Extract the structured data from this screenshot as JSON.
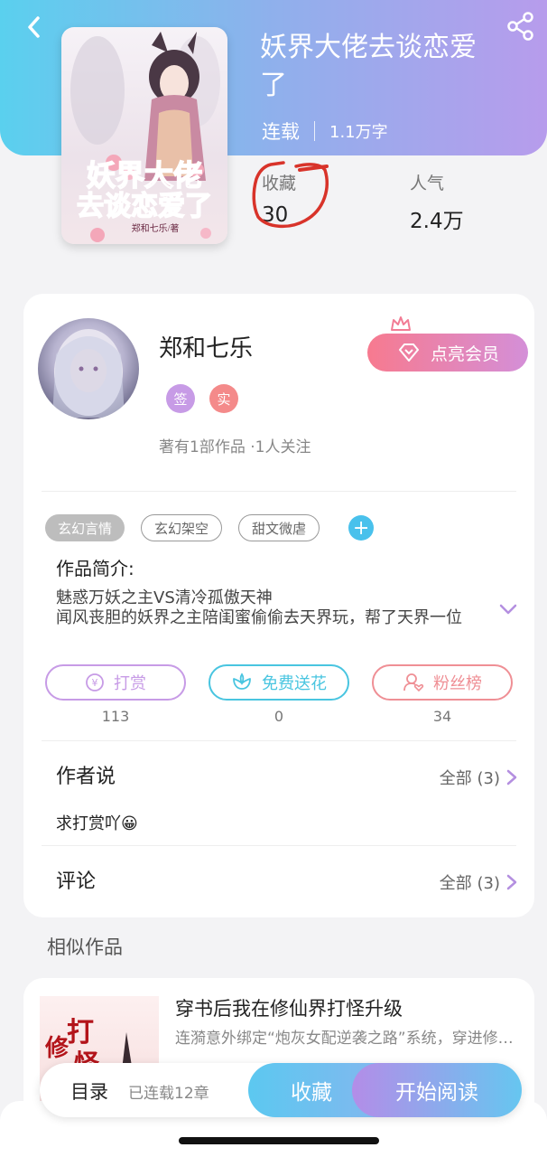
{
  "book": {
    "title_line1": "妖界大佬去谈恋爱",
    "title_line2": "了",
    "status": "连载",
    "word_count": "1.1万字",
    "cover_text_line1": "妖界大佬",
    "cover_text_line2": "去谈恋爱了",
    "cover_author": "郑和七乐/著"
  },
  "stats": {
    "collect_label": "收藏",
    "collect_value": "30",
    "popularity_label": "人气",
    "popularity_value": "2.4万"
  },
  "author": {
    "name": "郑和七乐",
    "badge_signed": "签",
    "badge_verified": "实",
    "info": "著有1部作品 ·1人关注",
    "vip_button": "点亮会员"
  },
  "tags": [
    "玄幻言情",
    "玄幻架空",
    "甜文微虐"
  ],
  "intro": {
    "label": "作品简介:",
    "line1": "魅惑万妖之主VS清冷孤傲天神",
    "line2": "闻风丧胆的妖界之主陪闺蜜偷偷去天界玩，帮了天界一位"
  },
  "actions": [
    {
      "label": "打赏",
      "count": "113"
    },
    {
      "label": "免费送花",
      "count": "0"
    },
    {
      "label": "粉丝榜",
      "count": "34"
    }
  ],
  "author_says": {
    "title": "作者说",
    "all": "全部 (3)",
    "content": "求打赏吖😀"
  },
  "comments": {
    "title": "评论",
    "all": "全部 (3)"
  },
  "similar": {
    "label": "相似作品",
    "title": "穿书后我在修仙界打怪升级",
    "desc": "连漪意外绑定“炮灰女配逆袭之路”系统，穿进修仙小说里"
  },
  "bottom": {
    "toc": "目录",
    "chapters": "已连载12章",
    "collect": "收藏",
    "read": "开始阅读"
  },
  "colors": {
    "accent_blue": "#49c1ec",
    "accent_purple": "#b38de8",
    "reward_purple": "#c79be6",
    "flower_cyan": "#49c5e0",
    "fans_pink": "#ef8f95",
    "annotation_red": "#d8332a"
  }
}
